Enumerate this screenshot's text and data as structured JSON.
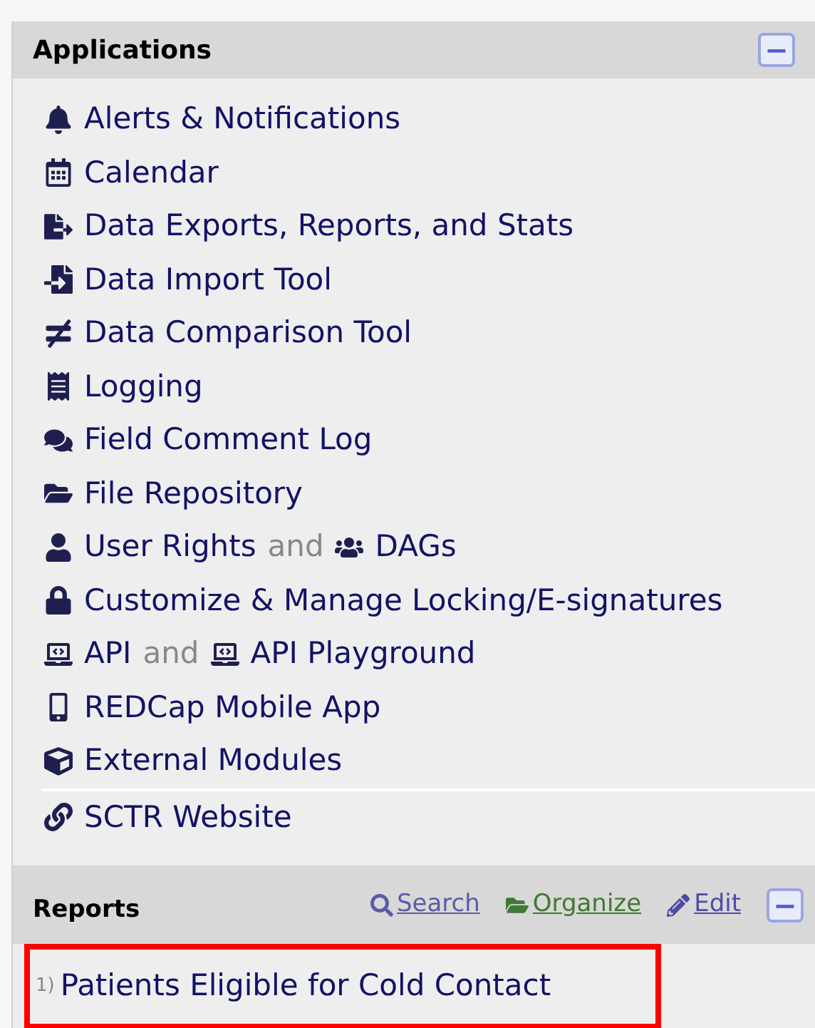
{
  "applications": {
    "title": "Applications",
    "collapse_icon": "−",
    "items": [
      {
        "kind": "link",
        "links": [
          {
            "label": "Alerts & Notifications"
          }
        ]
      },
      {
        "kind": "link",
        "links": [
          {
            "label": "Calendar"
          }
        ]
      },
      {
        "kind": "link",
        "links": [
          {
            "label": "Data Exports, Reports, and Stats"
          }
        ]
      },
      {
        "kind": "link",
        "links": [
          {
            "label": "Data Import Tool"
          }
        ]
      },
      {
        "kind": "link",
        "links": [
          {
            "label": "Data Comparison Tool"
          }
        ]
      },
      {
        "kind": "link",
        "links": [
          {
            "label": "Logging"
          }
        ]
      },
      {
        "kind": "link",
        "links": [
          {
            "label": "Field Comment Log"
          }
        ]
      },
      {
        "kind": "link",
        "links": [
          {
            "label": "File Repository"
          }
        ]
      },
      {
        "kind": "pair",
        "joiner": "and",
        "links": [
          {
            "label": "User Rights"
          },
          {
            "label": "DAGs"
          }
        ]
      },
      {
        "kind": "link",
        "links": [
          {
            "label": "Customize & Manage Locking/E-signatures"
          }
        ]
      },
      {
        "kind": "pair",
        "joiner": "and",
        "links": [
          {
            "label": "API"
          },
          {
            "label": "API Playground"
          }
        ]
      },
      {
        "kind": "link",
        "links": [
          {
            "label": "REDCap Mobile App"
          }
        ]
      },
      {
        "kind": "link",
        "links": [
          {
            "label": "External Modules"
          }
        ]
      },
      {
        "kind": "separator"
      },
      {
        "kind": "link",
        "links": [
          {
            "label": "SCTR Website"
          }
        ]
      }
    ]
  },
  "reports": {
    "title": "Reports",
    "collapse_icon": "−",
    "actions": [
      {
        "label": "Search"
      },
      {
        "label": "Organize"
      },
      {
        "label": "Edit"
      }
    ],
    "items": [
      {
        "number": "1)",
        "label": "Patients Eligible for Cold Contact",
        "highlighted": true
      }
    ]
  }
}
